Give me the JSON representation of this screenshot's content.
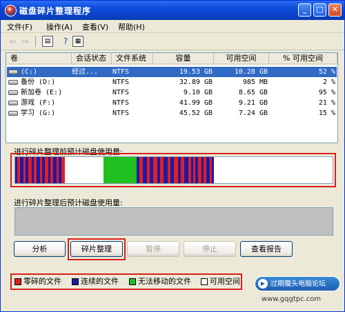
{
  "window": {
    "title": "磁盘碎片整理程序",
    "controls": {
      "minimize": "_",
      "maximize": "□",
      "close": "✕"
    }
  },
  "menu": [
    {
      "label": "文件(F)"
    },
    {
      "label": "操作(A)"
    },
    {
      "label": "查看(V)"
    },
    {
      "label": "帮助(H)"
    }
  ],
  "toolbar": {
    "icons": [
      "back-arrow-icon",
      "forward-arrow-icon",
      "view-icon",
      "help-icon",
      "properties-icon"
    ],
    "back": "⇦",
    "forward": "⇨",
    "view": "▤",
    "help": "?",
    "props": "▦"
  },
  "volumes": {
    "columns": [
      "卷",
      "会话状态",
      "文件系统",
      "容量",
      "可用空间",
      "% 可用空间"
    ],
    "rows": [
      {
        "name": "(C:)",
        "status": "经过...",
        "fs": "NTFS",
        "capacity": "19.53 GB",
        "free": "10.28 GB",
        "pct": "52 %",
        "selected": true
      },
      {
        "name": "备份 (D:)",
        "status": "",
        "fs": "NTFS",
        "capacity": "32.89 GB",
        "free": "985 MB",
        "pct": "2 %",
        "selected": false
      },
      {
        "name": "新加卷 (E:)",
        "status": "",
        "fs": "NTFS",
        "capacity": "9.10 GB",
        "free": "8.65 GB",
        "pct": "95 %",
        "selected": false
      },
      {
        "name": "游戏 (F:)",
        "status": "",
        "fs": "NTFS",
        "capacity": "41.99 GB",
        "free": "9.21 GB",
        "pct": "21 %",
        "selected": false
      },
      {
        "name": "学习 (G:)",
        "status": "",
        "fs": "NTFS",
        "capacity": "45.52 GB",
        "free": "7.24 GB",
        "pct": "15 %",
        "selected": false
      }
    ]
  },
  "analysis": {
    "before_label": "进行碎片整理前预计磁盘使用量:",
    "after_label": "进行碎片整理后预计磁盘使用量:"
  },
  "buttons": [
    {
      "label": "分析",
      "enabled": true
    },
    {
      "label": "碎片整理",
      "enabled": true
    },
    {
      "label": "暂停",
      "enabled": false
    },
    {
      "label": "停止",
      "enabled": false
    },
    {
      "label": "查看报告",
      "enabled": true
    }
  ],
  "legend": [
    {
      "label": "零碎的文件",
      "color": "#e02020"
    },
    {
      "label": "连续的文件",
      "color": "#1a1aa8"
    },
    {
      "label": "无法移动的文件",
      "color": "#20c020"
    },
    {
      "label": "可用空间",
      "color": "#ffffff"
    }
  ],
  "watermark": {
    "badge": "过期魔头电脑论坛",
    "play": "▶",
    "url": "www.gqgtpc.com"
  },
  "colors": {
    "fragmented": "#e02020",
    "contiguous": "#1a1aa8",
    "unmovable": "#20c020",
    "free": "#ffffff",
    "selection": "#316ac5",
    "highlight": "#d8201b"
  }
}
